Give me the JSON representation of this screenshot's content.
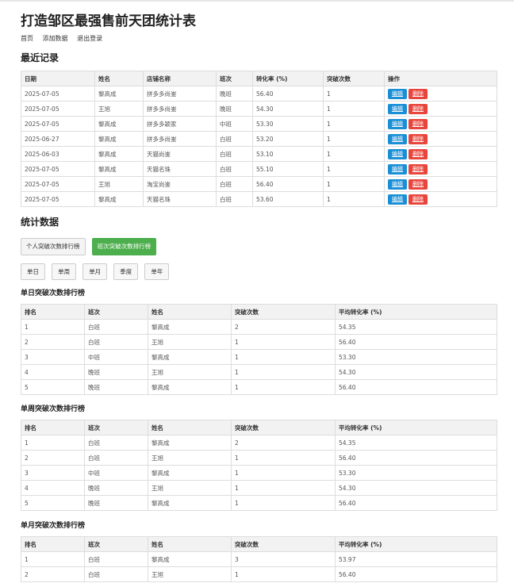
{
  "title": "打造邹区最强售前天团统计表",
  "nav": {
    "home": "首页",
    "add": "添加数据",
    "logout": "退出登录"
  },
  "recent": {
    "heading": "最近记录",
    "columns": [
      "日期",
      "姓名",
      "店铺名称",
      "班次",
      "转化率 (%)",
      "突破次数",
      "操作"
    ],
    "edit_label": "编辑",
    "delete_label": "删除",
    "rows": [
      [
        "2025-07-05",
        "黎高成",
        "拼多多尚崟",
        "晚班",
        "56.40",
        "1"
      ],
      [
        "2025-07-05",
        "王旭",
        "拼多多尚崟",
        "晚班",
        "54.30",
        "1"
      ],
      [
        "2025-07-05",
        "黎高成",
        "拼多多颖家",
        "中班",
        "53.30",
        "1"
      ],
      [
        "2025-06-27",
        "黎高成",
        "拼多多尚崟",
        "白班",
        "53.20",
        "1"
      ],
      [
        "2025-06-03",
        "黎高成",
        "天猫尚崟",
        "白班",
        "53.10",
        "1"
      ],
      [
        "2025-07-05",
        "黎高成",
        "天猫名珠",
        "白班",
        "55.10",
        "1"
      ],
      [
        "2025-07-05",
        "王旭",
        "淘宝尚崟",
        "白班",
        "56.40",
        "1"
      ],
      [
        "2025-07-05",
        "黎高成",
        "天猫名珠",
        "白班",
        "53.60",
        "1"
      ]
    ]
  },
  "stats": {
    "heading": "统计数据",
    "tabs": [
      "个人突破次数排行榜",
      "班次突破次数排行榜"
    ],
    "periods": [
      "单日",
      "单周",
      "单月",
      "季度",
      "单年"
    ],
    "columns": [
      "排名",
      "班次",
      "姓名",
      "突破次数",
      "平均转化率 (%)"
    ],
    "tables": [
      {
        "title": "单日突破次数排行榜",
        "rows": [
          [
            "1",
            "白班",
            "黎高成",
            "2",
            "54.35"
          ],
          [
            "2",
            "白班",
            "王旭",
            "1",
            "56.40"
          ],
          [
            "3",
            "中班",
            "黎高成",
            "1",
            "53.30"
          ],
          [
            "4",
            "晚班",
            "王旭",
            "1",
            "54.30"
          ],
          [
            "5",
            "晚班",
            "黎高成",
            "1",
            "56.40"
          ]
        ]
      },
      {
        "title": "单周突破次数排行榜",
        "rows": [
          [
            "1",
            "白班",
            "黎高成",
            "2",
            "54.35"
          ],
          [
            "2",
            "白班",
            "王旭",
            "1",
            "56.40"
          ],
          [
            "3",
            "中班",
            "黎高成",
            "1",
            "53.30"
          ],
          [
            "4",
            "晚班",
            "王旭",
            "1",
            "54.30"
          ],
          [
            "5",
            "晚班",
            "黎高成",
            "1",
            "56.40"
          ]
        ]
      },
      {
        "title": "单月突破次数排行榜",
        "rows": [
          [
            "1",
            "白班",
            "黎高成",
            "3",
            "53.97"
          ],
          [
            "2",
            "白班",
            "王旭",
            "1",
            "56.40"
          ]
        ]
      }
    ]
  }
}
